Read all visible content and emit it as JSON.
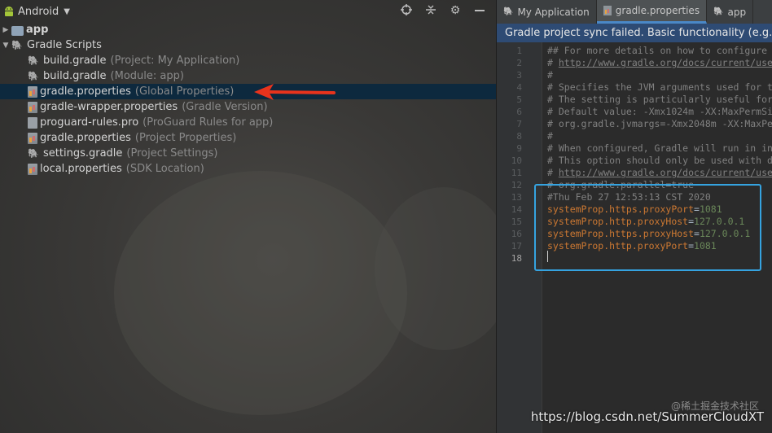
{
  "project_pane": {
    "view_name": "Android",
    "tree": [
      {
        "name": "app",
        "hint": "",
        "icon": "folder-icon",
        "level": 0,
        "expanded": false
      },
      {
        "name": "Gradle Scripts",
        "hint": "",
        "icon": "gradle-icon",
        "level": 0,
        "expanded": true
      },
      {
        "name": "build.gradle",
        "hint": "(Project: My Application)",
        "icon": "gradle-icon",
        "level": 1
      },
      {
        "name": "build.gradle",
        "hint": "(Module: app)",
        "icon": "gradle-icon",
        "level": 1
      },
      {
        "name": "gradle.properties",
        "hint": "(Global Properties)",
        "icon": "properties-file-icon",
        "level": 1,
        "selected": true
      },
      {
        "name": "gradle-wrapper.properties",
        "hint": "(Gradle Version)",
        "icon": "properties-file-icon",
        "level": 1
      },
      {
        "name": "proguard-rules.pro",
        "hint": "(ProGuard Rules for app)",
        "icon": "proguard-file-icon",
        "level": 1
      },
      {
        "name": "gradle.properties",
        "hint": "(Project Properties)",
        "icon": "properties-file-icon",
        "level": 1
      },
      {
        "name": "settings.gradle",
        "hint": "(Project Settings)",
        "icon": "gradle-icon",
        "level": 1
      },
      {
        "name": "local.properties",
        "hint": "(SDK Location)",
        "icon": "properties-file-icon",
        "level": 1
      }
    ]
  },
  "editor": {
    "tabs": [
      {
        "label": "My Application",
        "icon": "gradle-icon",
        "active": false
      },
      {
        "label": "gradle.properties",
        "icon": "properties-file-icon",
        "active": true
      },
      {
        "label": "app",
        "icon": "gradle-icon",
        "active": false
      }
    ],
    "sync_banner": "Gradle project sync failed. Basic functionality (e.g. ed",
    "current_line": 18,
    "lines": [
      {
        "n": "1",
        "parts": [
          {
            "t": "## For more details on how to configure",
            "c": "comment"
          }
        ]
      },
      {
        "n": "2",
        "parts": [
          {
            "t": "# ",
            "c": "comment"
          },
          {
            "t": "http://www.gradle.org/docs/current/use",
            "c": "link"
          }
        ]
      },
      {
        "n": "3",
        "parts": [
          {
            "t": "#",
            "c": "comment"
          }
        ]
      },
      {
        "n": "4",
        "parts": [
          {
            "t": "# Specifies the JVM arguments used for t",
            "c": "comment"
          }
        ]
      },
      {
        "n": "5",
        "parts": [
          {
            "t": "# The setting is particularly useful for",
            "c": "comment"
          }
        ]
      },
      {
        "n": "6",
        "parts": [
          {
            "t": "# Default value: -Xmx1024m -XX:MaxPermSi",
            "c": "comment"
          }
        ]
      },
      {
        "n": "7",
        "parts": [
          {
            "t": "# org.gradle.jvmargs=-Xmx2048m -XX:MaxPe",
            "c": "comment"
          }
        ]
      },
      {
        "n": "8",
        "parts": [
          {
            "t": "#",
            "c": "comment"
          }
        ]
      },
      {
        "n": "9",
        "parts": [
          {
            "t": "# When configured, Gradle will run in in",
            "c": "comment"
          }
        ]
      },
      {
        "n": "10",
        "parts": [
          {
            "t": "# This option should only be used with d",
            "c": "comment"
          }
        ]
      },
      {
        "n": "11",
        "parts": [
          {
            "t": "# ",
            "c": "comment"
          },
          {
            "t": "http://www.gradle.org/docs/current/use",
            "c": "link"
          }
        ]
      },
      {
        "n": "12",
        "parts": [
          {
            "t": "# org.gradle.parallel=true",
            "c": "comment"
          }
        ]
      },
      {
        "n": "13",
        "parts": [
          {
            "t": "#Thu Feb 27 12:53:13 CST 2020",
            "c": "comment"
          }
        ]
      },
      {
        "n": "14",
        "parts": [
          {
            "t": "systemProp.https.proxyPort",
            "c": "key"
          },
          {
            "t": "=",
            "c": "eq"
          },
          {
            "t": "1081",
            "c": "val"
          }
        ]
      },
      {
        "n": "15",
        "parts": [
          {
            "t": "systemProp.http.proxyHost",
            "c": "key"
          },
          {
            "t": "=",
            "c": "eq"
          },
          {
            "t": "127.0.0.1",
            "c": "val"
          }
        ]
      },
      {
        "n": "16",
        "parts": [
          {
            "t": "systemProp.https.proxyHost",
            "c": "key"
          },
          {
            "t": "=",
            "c": "eq"
          },
          {
            "t": "127.0.0.1",
            "c": "val"
          }
        ]
      },
      {
        "n": "17",
        "parts": [
          {
            "t": "systemProp.http.proxyPort",
            "c": "key"
          },
          {
            "t": "=",
            "c": "eq"
          },
          {
            "t": "1081",
            "c": "val"
          }
        ]
      },
      {
        "n": "18",
        "parts": []
      }
    ]
  },
  "watermark": "https://blog.csdn.net/SummerCloudXT",
  "watermark_site": "@稀土掘金技术社区",
  "colors": {
    "selection": "#0d293e",
    "highlight_box": "#35a3e0",
    "annotation_arrow": "#e8331c",
    "banner": "#2e4b74"
  }
}
